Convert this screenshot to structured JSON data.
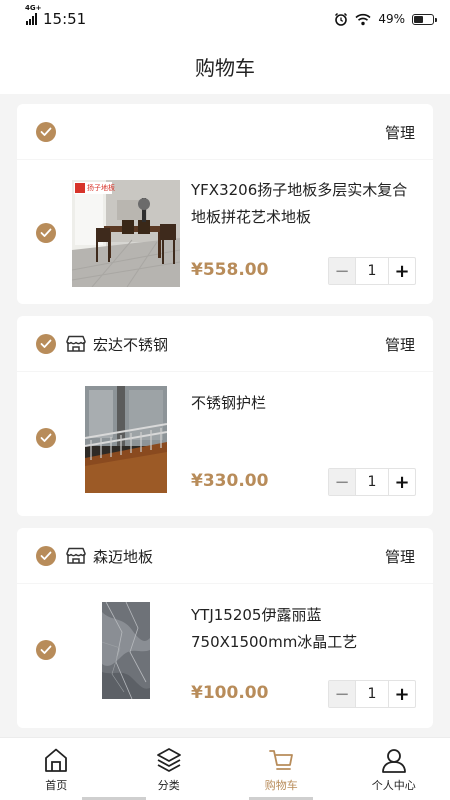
{
  "status_bar": {
    "time": "15:51",
    "network": "4G+",
    "battery": "49%"
  },
  "header": {
    "title": "购物车"
  },
  "carts": [
    {
      "shop_name": "",
      "manage_label": "管理",
      "item": {
        "title": "YFX3206扬子地板多层实木复合地板拼花艺术地板",
        "price": "¥558.00",
        "quantity": "1"
      }
    },
    {
      "shop_name": "宏达不锈钢",
      "manage_label": "管理",
      "item": {
        "title": "不锈钢护栏",
        "price": "¥330.00",
        "quantity": "1"
      }
    },
    {
      "shop_name": "森迈地板",
      "manage_label": "管理",
      "item": {
        "title": "YTJ15205伊露丽蓝750X1500mm冰晶工艺",
        "price": "¥100.00",
        "quantity": "1"
      }
    }
  ],
  "product_badge": "扬子地板",
  "stepper": {
    "minus": "−",
    "plus": "+"
  },
  "tabbar": {
    "tabs": [
      {
        "label": "首页",
        "icon": "home-icon"
      },
      {
        "label": "分类",
        "icon": "layers-icon"
      },
      {
        "label": "购物车",
        "icon": "cart-icon",
        "active": true
      },
      {
        "label": "个人中心",
        "icon": "user-icon"
      }
    ]
  },
  "colors": {
    "accent": "#b88c5a",
    "background": "#f4f4f4",
    "card": "#ffffff"
  }
}
